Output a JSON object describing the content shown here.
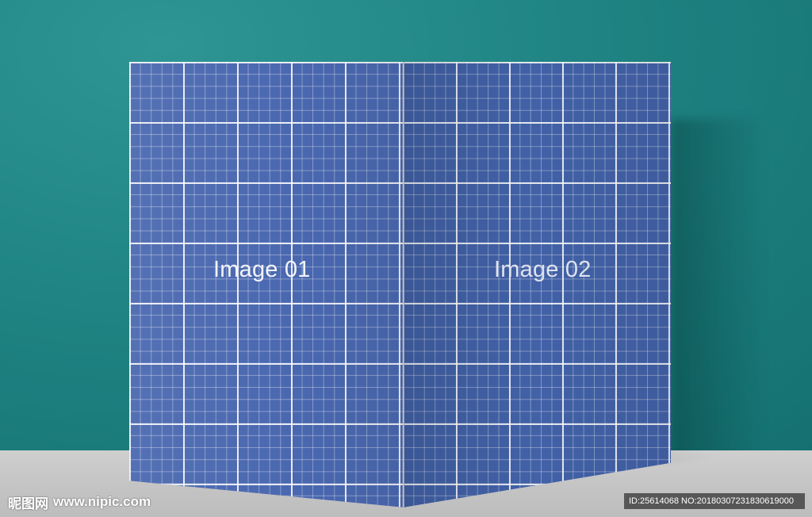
{
  "scene": {
    "panel_left_label": "Image 01",
    "panel_right_label": "Image 02"
  },
  "watermark": {
    "site_mark": "昵图网",
    "site_url": "www.nipic.com",
    "id_text": "ID:25614068 NO:20180307231830619000"
  },
  "colors": {
    "wall": "#1f8483",
    "floor": "#c6c6c6",
    "panel": "#4a68b0",
    "grid_line": "#ffffff"
  }
}
